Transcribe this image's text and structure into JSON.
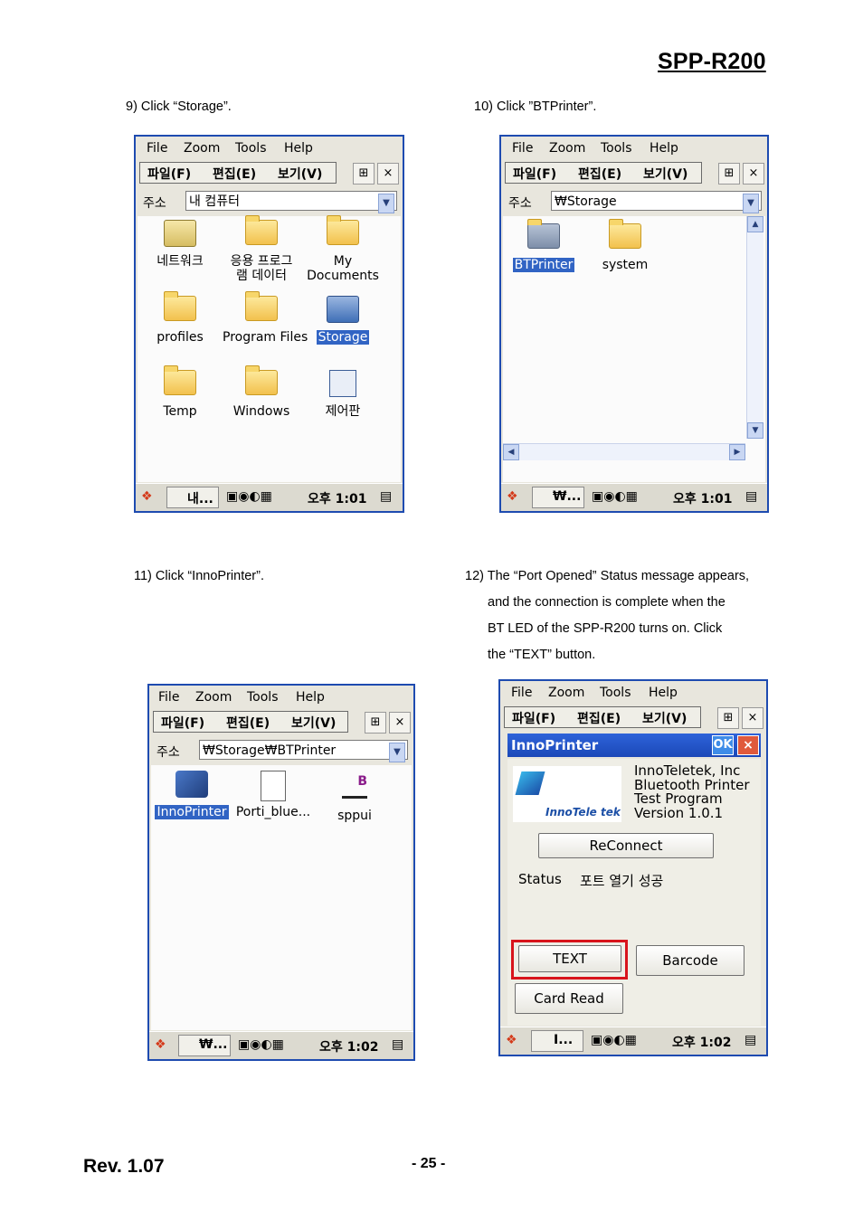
{
  "header": {
    "title": "SPP-R200"
  },
  "footer": {
    "revision": "Rev. 1.07",
    "page": "- 25 -"
  },
  "steps": {
    "s9": "9) Click “Storage”.",
    "s10": "10) Click ”BTPrinter”.",
    "s11": "11) Click “InnoPrinter”.",
    "s12": [
      "12) The “Port Opened” Status message appears,",
      "and the connection is complete when the",
      "BT  LED  of  the  SPP-R200  turns  on.   Click",
      "the “TEXT” button."
    ]
  },
  "common": {
    "menu": [
      "File",
      "Zoom",
      "Tools",
      "Help"
    ],
    "kmenu": [
      "파일(F)",
      "편집(E)",
      "보기(V)"
    ],
    "address_label": "주소",
    "close": "×",
    "tray_time_101": "오후 1:01",
    "tray_time_102": "오후 1:02"
  },
  "shot1": {
    "address": "내 컴퓨터",
    "task": "내...",
    "items": [
      "네트워크",
      "응용 프로그\n램 데이터",
      "My\nDocuments",
      "profiles",
      "Program Files",
      "Storage",
      "Temp",
      "Windows",
      "제어판"
    ],
    "selected": "Storage"
  },
  "shot2": {
    "address": "₩Storage",
    "task": "₩...",
    "items": [
      "BTPrinter",
      "system"
    ],
    "selected": "BTPrinter"
  },
  "shot3": {
    "address": "₩Storage₩BTPrinter",
    "task": "₩...",
    "items": [
      "InnoPrinter",
      "Porti_blue...",
      "sppui"
    ],
    "selected": "InnoPrinter"
  },
  "shot4": {
    "app_title": "InnoPrinter",
    "ok": "OK",
    "logo_text": "InnoTele tek",
    "info": [
      "InnoTeletek, Inc",
      "Bluetooth Printer",
      "Test Program",
      "Version 1.0.1"
    ],
    "reconnect": "ReConnect",
    "status_label": "Status",
    "status_value": "포트 열기 성공",
    "text_button": "TEXT",
    "barcode_button": "Barcode",
    "card_read_button": "Card Read",
    "task": "I..."
  }
}
